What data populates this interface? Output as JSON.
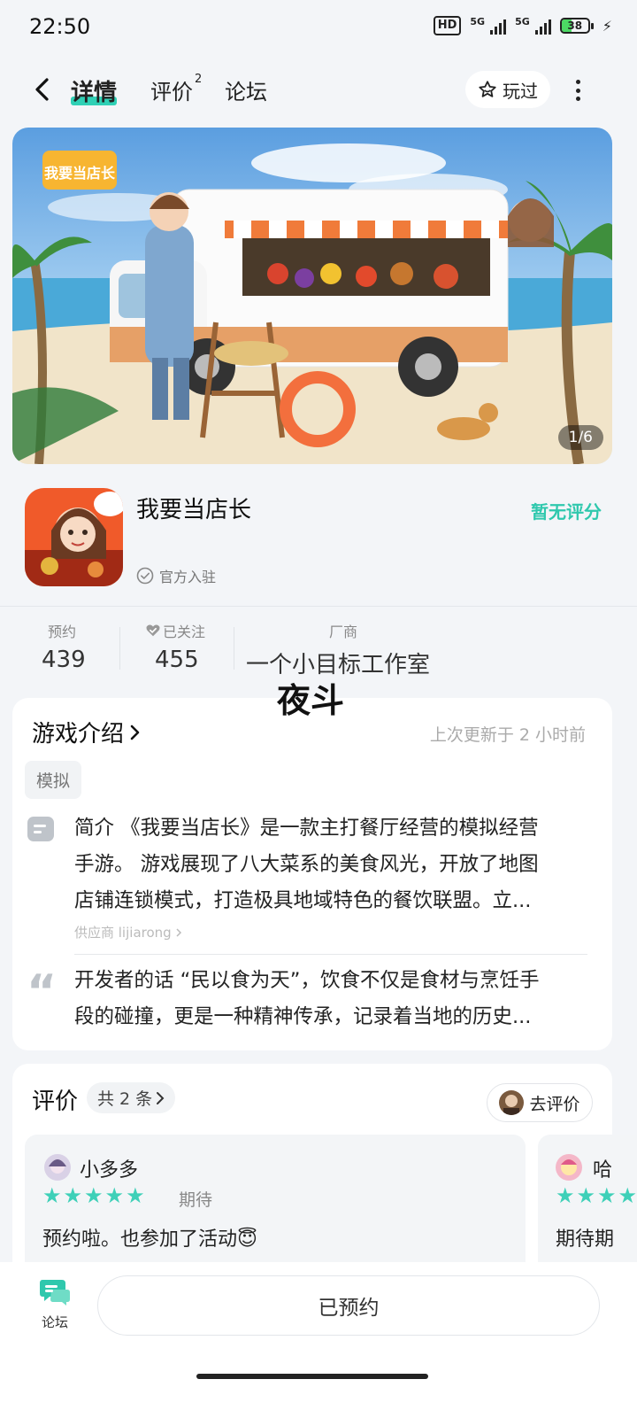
{
  "status": {
    "time": "22:50",
    "network1": "5G",
    "network2": "5G",
    "battery": "38",
    "hd": "HD"
  },
  "nav": {
    "tabs": [
      {
        "label": "详情"
      },
      {
        "label": "评价",
        "badge": "2"
      },
      {
        "label": "论坛"
      }
    ],
    "played_label": "玩过"
  },
  "banner": {
    "counter": "1/6",
    "logo_text": "我要当店长"
  },
  "app": {
    "name": "我要当店长",
    "rating": "暂无评分",
    "official": "官方入驻"
  },
  "stats": {
    "reserve_label": "预约",
    "reserve_value": "439",
    "follow_label": "已关注",
    "follow_value": "455",
    "vendor_label": "厂商",
    "vendor_value": "一个小目标工作室"
  },
  "overlay_text": "夜斗",
  "intro": {
    "title": "游戏介绍",
    "updated": "上次更新于 2 小时前",
    "tag": "模拟",
    "summary_lines": [
      "简介 《我要当店长》是一款主打餐厅经营的模拟经营",
      "手游。 游戏展现了八大菜系的美食风光，开放了地图",
      "店铺连锁模式，打造极具地域特色的餐饮联盟。立..."
    ],
    "supplier": "供应商 lijiarong",
    "dev_lines": [
      "开发者的话 “民以食为天”，饮食不仅是食材与烹饪手",
      "段的碰撞，更是一种精神传承，记录着当地的历史..."
    ]
  },
  "reviews": {
    "title": "评价",
    "count": "共 2 条",
    "go_review": "去评价",
    "items": [
      {
        "user": "小多多",
        "stars": 5,
        "tag": "期待",
        "text": "预约啦。也参加了活动😇"
      },
      {
        "user": "哈",
        "stars": 5,
        "tag": "",
        "text": "期待期"
      }
    ]
  },
  "bottom": {
    "forum_label": "论坛",
    "reserved_label": "已预约"
  },
  "colors": {
    "accent": "#2fd0b5",
    "star": "#3ed0b8",
    "background": "#f3f5f8"
  }
}
